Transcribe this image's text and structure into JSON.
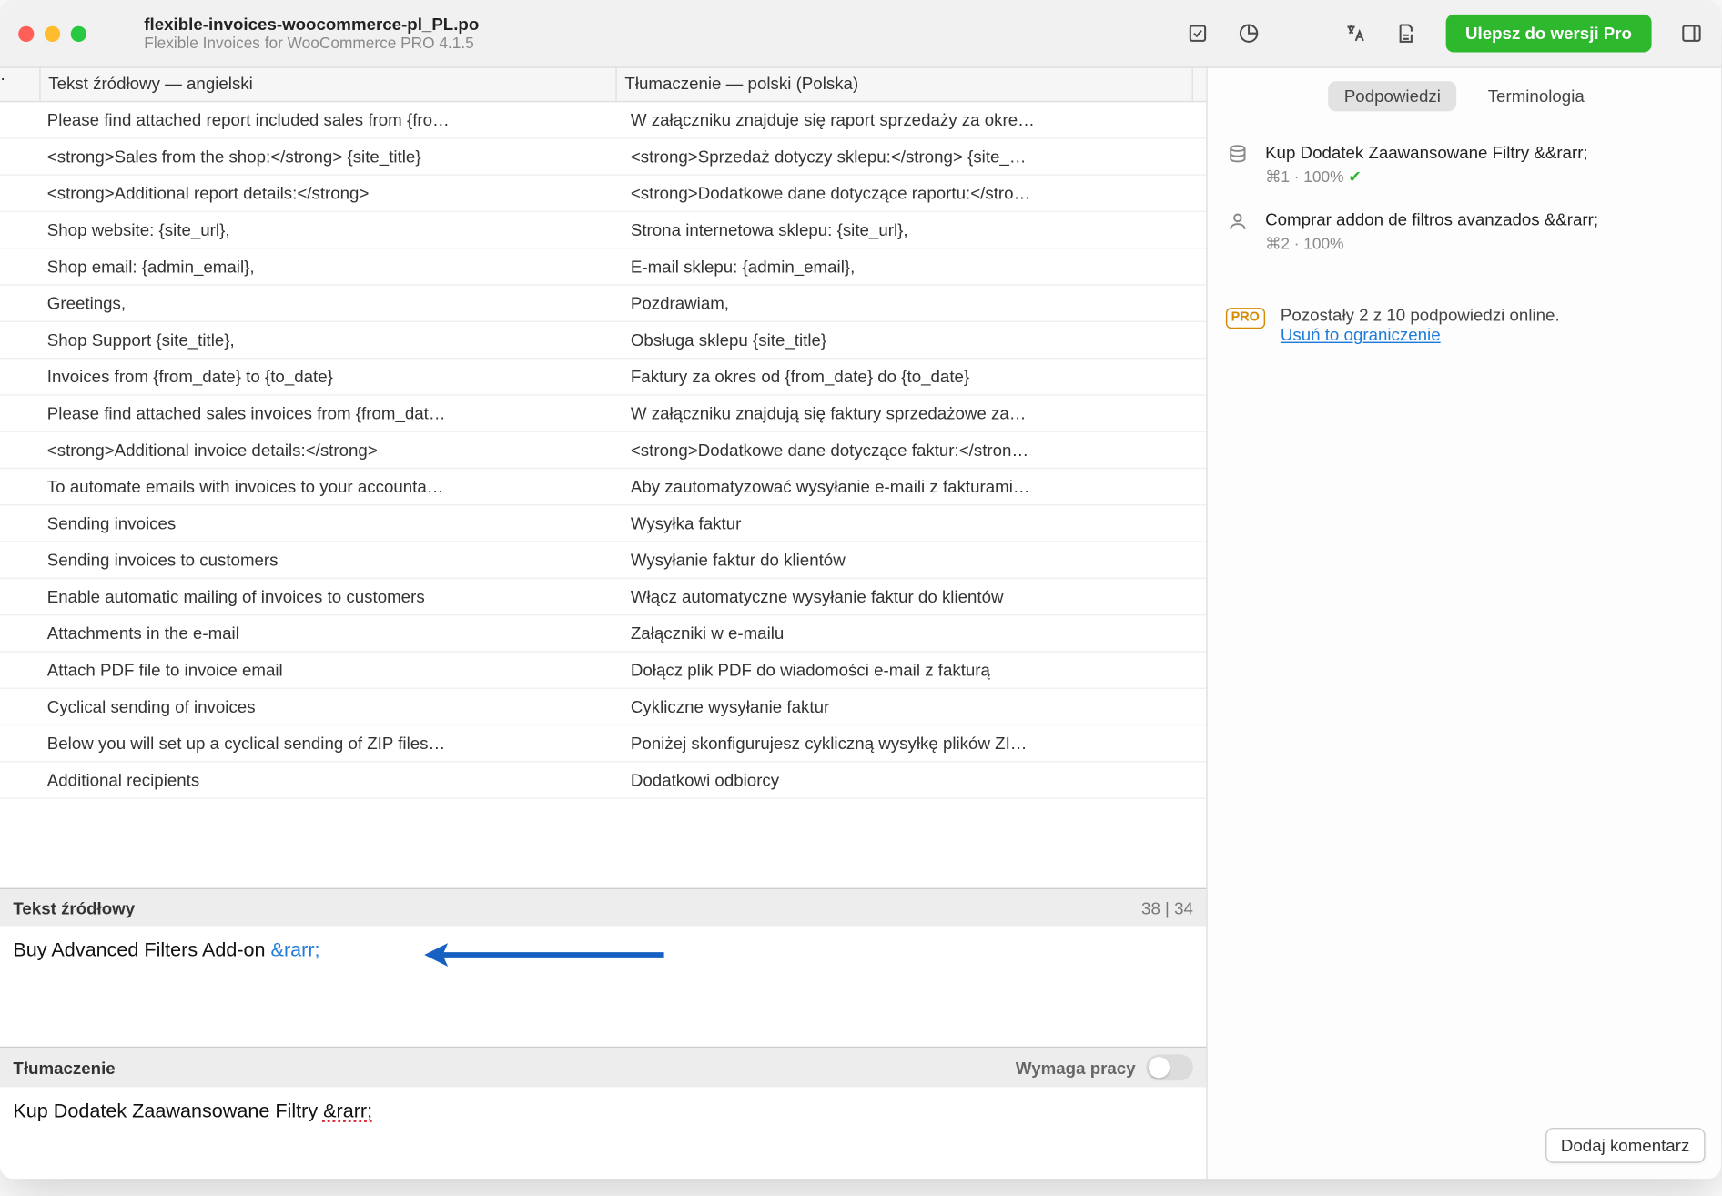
{
  "titlebar": {
    "filename": "flexible-invoices-woocommerce-pl_PL.po",
    "subtitle": "Flexible Invoices for WooCommerce PRO 4.1.5",
    "upgrade_label": "Ulepsz do wersji Pro",
    "icons": {
      "validate": "validate",
      "stats": "stats",
      "translate": "translate",
      "print": "print",
      "sidebar": "sidebar"
    }
  },
  "columns": {
    "source": "Tekst źródłowy — angielski",
    "target": "Tłumaczenie — polski (Polska)"
  },
  "rows": [
    {
      "src": "Please find attached report included sales from {fro…",
      "trg": "W załączniku znajduje się raport sprzedaży za okre…"
    },
    {
      "src": "<strong>Sales from the shop:</strong> {site_title}",
      "trg": "<strong>Sprzedaż dotyczy sklepu:</strong> {site_…"
    },
    {
      "src": "<strong>Additional report details:</strong>",
      "trg": "<strong>Dodatkowe dane dotyczące raportu:</stro…"
    },
    {
      "src": "Shop website: {site_url},",
      "trg": "Strona internetowa sklepu: {site_url},"
    },
    {
      "src": "Shop email: {admin_email},",
      "trg": "E-mail sklepu: {admin_email},"
    },
    {
      "src": "Greetings,",
      "trg": "Pozdrawiam,"
    },
    {
      "src": "Shop Support {site_title},",
      "trg": "Obsługa sklepu {site_title}"
    },
    {
      "src": "Invoices from {from_date} to {to_date}",
      "trg": "Faktury za okres od {from_date} do {to_date}"
    },
    {
      "src": "Please find attached sales invoices from {from_dat…",
      "trg": "W załączniku znajdują się faktury sprzedażowe za…"
    },
    {
      "src": "<strong>Additional invoice details:</strong>",
      "trg": "<strong>Dodatkowe dane dotyczące faktur:</stron…"
    },
    {
      "src": "To automate emails with invoices to your accounta…",
      "trg": "Aby zautomatyzować wysyłanie e-maili z fakturami…"
    },
    {
      "src": "Sending invoices",
      "trg": "Wysyłka faktur"
    },
    {
      "src": "Sending invoices to customers",
      "trg": "Wysyłanie faktur do klientów"
    },
    {
      "src": "Enable automatic mailing of invoices to customers",
      "trg": "Włącz automatyczne wysyłanie faktur do klientów"
    },
    {
      "src": "Attachments in the e-mail",
      "trg": "Załączniki w e-mailu"
    },
    {
      "src": "Attach PDF file to invoice email",
      "trg": "Dołącz plik PDF do wiadomości e-mail z fakturą"
    },
    {
      "src": "Cyclical sending of invoices",
      "trg": "Cykliczne wysyłanie faktur"
    },
    {
      "src": "Below you will set up a cyclical sending of ZIP files…",
      "trg": "Poniżej skonfigurujesz cykliczną wysyłkę plików ZI…"
    },
    {
      "src": "Additional recipients",
      "trg": "Dodatkowi odbiorcy"
    }
  ],
  "source_panel": {
    "label": "Tekst źródłowy",
    "counter": "38 | 34",
    "text_main": "Buy Advanced Filters Add-on ",
    "text_entity": "&rarr;"
  },
  "trans_panel": {
    "label": "Tłumaczenie",
    "needs_work": "Wymaga pracy",
    "text_main": "Kup Dodatek Zaawansowane Filtry ",
    "text_entity": "&rarr;"
  },
  "right": {
    "tabs": {
      "suggestions": "Podpowiedzi",
      "terminology": "Terminologia"
    },
    "suggestions": [
      {
        "icon": "db",
        "text": "Kup Dodatek Zaawansowane Filtry &&rarr;",
        "meta": "⌘1 · 100% ",
        "check": true
      },
      {
        "icon": "user",
        "text": "Comprar addon de filtros avanzados &&rarr;",
        "meta": "⌘2 · 100%"
      }
    ],
    "pro": {
      "badge": "PRO",
      "text": "Pozostały 2 z 10 podpowiedzi online.",
      "link": "Usuń to ograniczenie"
    },
    "add_comment": "Dodaj komentarz"
  }
}
